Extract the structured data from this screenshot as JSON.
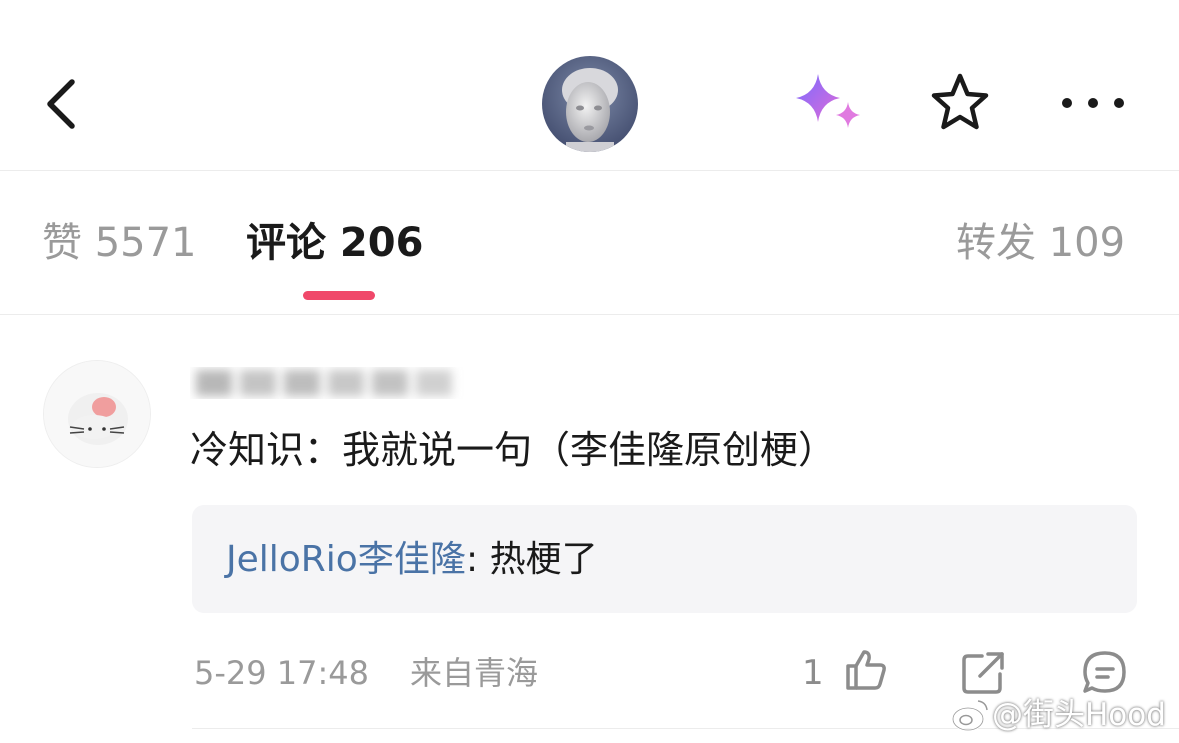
{
  "header": {
    "back_icon": "chevron-left-icon",
    "avatar_icon": "statue-avatar",
    "ai_icon": "sparkle-icon",
    "favorite_icon": "star-outline-icon",
    "more_icon": "ellipsis-icon"
  },
  "tabs": {
    "like": "赞 5571",
    "comment": "评论 206",
    "forward": "转发 109",
    "active_color": "#f0486a"
  },
  "comment": {
    "text": "冷知识：我就说一句（李佳隆原创梗）",
    "reply": {
      "author": "JelloRio李佳隆",
      "colon": ": ",
      "text": "热梗了"
    },
    "date": "5-29 17:48",
    "location": "来自青海",
    "like_count": "1"
  },
  "watermark": "@街头Hood",
  "colors": {
    "link": "#4a73a6",
    "muted": "#9a9a9a",
    "accent": "#f0486a"
  }
}
